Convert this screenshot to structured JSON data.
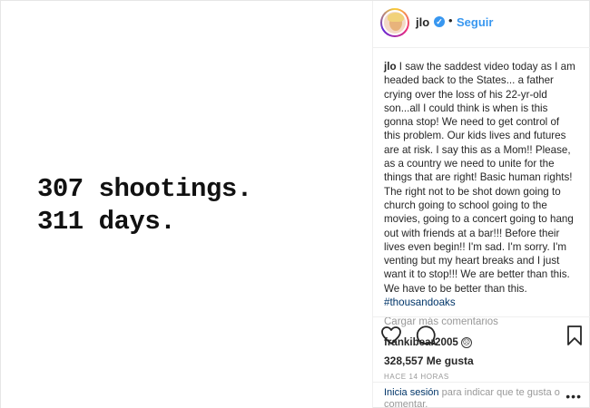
{
  "post_image": {
    "line1": "307 shootings.",
    "line2": "311 days."
  },
  "header": {
    "username": "jlo",
    "verified_icon": "verified-badge-icon",
    "separator": "•",
    "follow_label": "Seguir"
  },
  "caption": {
    "username": "jlo",
    "text": " I saw the saddest video today as I am headed back to the States... a father crying over the loss of his 22-yr-old son...all I could think is when is this gonna stop! We need to get control of this problem. Our kids lives and futures are at risk. I say this as a Mom!! Please, as a country we need to unite for the things that are right! Basic human rights! The right not to be shot down going to church going to school going to the movies, going to a concert going to hang out with friends at a bar!!! Before their lives even begin!! I'm sad. I'm sorry. I'm venting but my heart breaks and I just want it to stop!!! We are better than this. We have to be better than this.",
    "hashtag": "#thousandoaks"
  },
  "load_more_label": "Cargar más comentarios",
  "comment": {
    "username": "frankibear2005",
    "emoji": "☹"
  },
  "actions": {
    "like_icon": "heart-icon",
    "comment_icon": "comment-icon",
    "save_icon": "bookmark-icon"
  },
  "likes_text": "328,557 Me gusta",
  "time_text": "HACE 14 HORAS",
  "login": {
    "link": "Inicia sesión",
    "rest": " para indicar que te gusta o comentar.",
    "more": "•••"
  }
}
